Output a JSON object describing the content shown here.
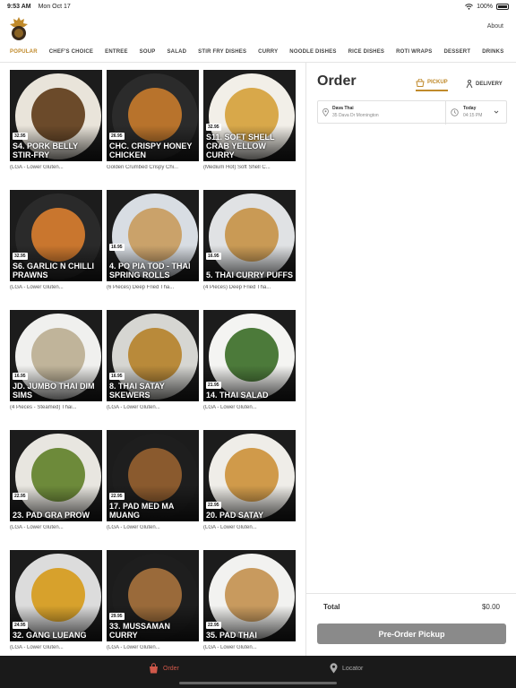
{
  "status_bar": {
    "time": "9:53 AM",
    "date": "Mon Oct 17",
    "battery": "100%"
  },
  "header": {
    "about_label": "About"
  },
  "categories": [
    "POPULAR",
    "CHEF'S CHOICE",
    "ENTREE",
    "SOUP",
    "SALAD",
    "STIR FRY DISHES",
    "CURRY",
    "NOODLE DISHES",
    "RICE DISHES",
    "ROTI WRAPS",
    "DESSERT",
    "DRINKS"
  ],
  "active_category": "POPULAR",
  "menu_items": [
    {
      "price": "32.95",
      "name": "S4. PORK BELLY STIR-FRY",
      "desc": "(LGA - Lower Gluten..."
    },
    {
      "price": "26.95",
      "name": "CHC. CRISPY HONEY CHICKEN",
      "desc": "Golden Crumbed Crispy Chi..."
    },
    {
      "price": "32.95",
      "name": "S11. SOFT SHELL CRAB YELLOW CURRY",
      "desc": "(Medium Hot) Soft Shell C..."
    },
    {
      "price": "32.95",
      "name": "S6. GARLIC N CHILLI PRAWNS",
      "desc": "(LGA - Lower Gluten..."
    },
    {
      "price": "16.95",
      "name": "4. PO PIA TOD - THAI SPRING ROLLS",
      "desc": "(6 Pieces) Deep Fried Tha..."
    },
    {
      "price": "16.95",
      "name": "5. THAI CURRY PUFFS",
      "desc": "(4 Pieces) Deep Fried Tha..."
    },
    {
      "price": "16.95",
      "name": "JD. JUMBO THAI DIM SIMS",
      "desc": "(4 Pieces - Steamed) Thai..."
    },
    {
      "price": "16.95",
      "name": "8. THAI SATAY SKEWERS",
      "desc": "(LGA - Lower Gluten..."
    },
    {
      "price": "21.95",
      "name": "14. THAI SALAD",
      "desc": "(LGA - Lower Gluten..."
    },
    {
      "price": "22.95",
      "name": "23. PAD GRA PROW",
      "desc": "(LGA - Lower Gluten..."
    },
    {
      "price": "22.95",
      "name": "17. PAD MED MA MUANG",
      "desc": "(LGA - Lower Gluten..."
    },
    {
      "price": "22.95",
      "name": "20. PAD SATAY",
      "desc": "(LGA - Lower Gluten..."
    },
    {
      "price": "24.95",
      "name": "32. GANG LUEANG",
      "desc": "(LGA - Lower Gluten..."
    },
    {
      "price": "29.95",
      "name": "33. MUSSAMAN CURRY",
      "desc": "(LGA - Lower Gluten..."
    },
    {
      "price": "22.95",
      "name": "35. PAD THAI",
      "desc": "(LGA - Lower Gluten..."
    }
  ],
  "order_panel": {
    "title": "Order",
    "pickup_label": "PICKUP",
    "delivery_label": "DELIVERY",
    "store_name": "Dava Thai",
    "store_address": "35 Dava Dr Mornington",
    "day": "Today",
    "time": "04:15 PM",
    "total_label": "Total",
    "total_value": "$0.00",
    "button_label": "Pre-Order Pickup"
  },
  "bottom_nav": {
    "order_label": "Order",
    "locator_label": "Locator"
  },
  "colors": {
    "accent": "#c08a2b",
    "order_tab": "#d0584a",
    "button": "#8a8a8a"
  }
}
